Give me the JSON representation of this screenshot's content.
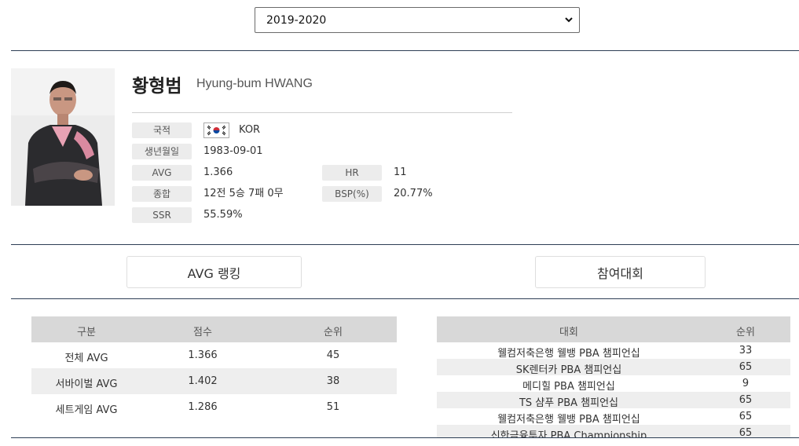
{
  "season": {
    "selected": "2019-2020"
  },
  "player": {
    "name_ko": "황형범",
    "name_en": "Hyung-bum HWANG",
    "nationality_label": "국적",
    "nationality": "KOR",
    "birth_label": "생년월일",
    "birth": "1983-09-01",
    "avg_label": "AVG",
    "avg": "1.366",
    "hr_label": "HR",
    "hr": "11",
    "record_label": "종합",
    "record": "12전 5승 7패 0무",
    "bsp_label": "BSP(%)",
    "bsp": "20.77%",
    "ssr_label": "SSR",
    "ssr": "55.59%"
  },
  "tabs": {
    "avg_ranking": "AVG 랭킹",
    "tournaments": "참여대회"
  },
  "avg_table": {
    "headers": [
      "구분",
      "점수",
      "순위"
    ],
    "rows": [
      [
        "전체 AVG",
        "1.366",
        "45"
      ],
      [
        "서바이벌 AVG",
        "1.402",
        "38"
      ],
      [
        "세트게임 AVG",
        "1.286",
        "51"
      ]
    ]
  },
  "tour_table": {
    "headers": [
      "대회",
      "순위"
    ],
    "rows": [
      [
        "웰컴저축은행 웰뱅 PBA 챔피언십",
        "33"
      ],
      [
        "SK렌터카 PBA 챔피언십",
        "65"
      ],
      [
        "메디힐 PBA 챔피언십",
        "9"
      ],
      [
        "TS 샴푸 PBA 챔피언십",
        "65"
      ],
      [
        "웰컴저축은행 웰뱅 PBA 챔피언십",
        "65"
      ],
      [
        "신한금융투자 PBA Championship",
        "65"
      ]
    ]
  }
}
